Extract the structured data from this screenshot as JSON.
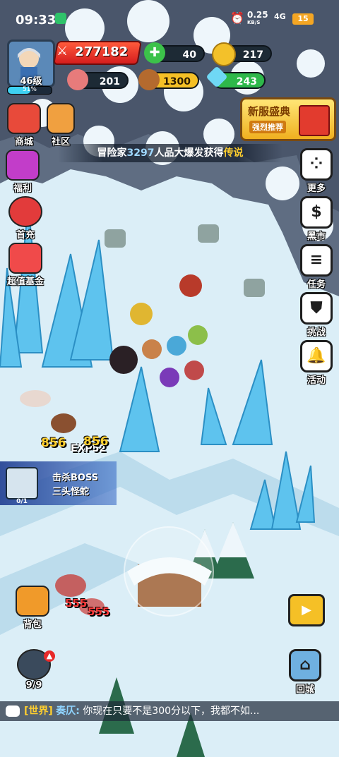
{
  "status_bar": {
    "time": "09:33",
    "net_speed": "0.25",
    "net_unit": "KB/S",
    "network": "4G",
    "battery": "15"
  },
  "player": {
    "level": "46级",
    "xp_percent": "51%",
    "xp_fraction": 0.51
  },
  "resources": {
    "combat_power": "277182",
    "green_gem": "40",
    "gold": "217",
    "meat": "201",
    "wood": "1300",
    "crystal": "243"
  },
  "left_menu": [
    {
      "label": "商城",
      "icon": "shop-icon"
    },
    {
      "label": "社区",
      "icon": "house-icon"
    },
    {
      "label": "福利",
      "icon": "gift-icon"
    },
    {
      "label": "首充",
      "icon": "hero-icon"
    },
    {
      "label": "超值基金",
      "icon": "fund-icon"
    }
  ],
  "right_menu": [
    {
      "label": "更多",
      "icon": "dice-icon"
    },
    {
      "label": "黑市",
      "icon": "moneybag-icon"
    },
    {
      "label": "任务",
      "icon": "list-icon"
    },
    {
      "label": "挑战",
      "icon": "shield-icon"
    },
    {
      "label": "活动",
      "icon": "bell-icon"
    }
  ],
  "promo": {
    "title": "新服盛典",
    "subtitle": "强烈推荐"
  },
  "ticker": {
    "prefix": "冒险家",
    "name": "3297",
    "text": "人品大爆发获得",
    "highlight": "传说"
  },
  "boss_quest": {
    "line1": "击杀BOSS",
    "line2": "三头怪蛇",
    "count": "0/1"
  },
  "damage_numbers": {
    "d1": "856",
    "exp": "EXP52",
    "d2": "856",
    "r1": "555",
    "r2": "555"
  },
  "bottom_buttons": {
    "bag": "背包",
    "hero_count": "9/9",
    "return_city": "回城"
  },
  "chat": {
    "channel": "[世界]",
    "sender": "奏仄:",
    "message": "你现在只要不是300分以下，我都不如..."
  }
}
